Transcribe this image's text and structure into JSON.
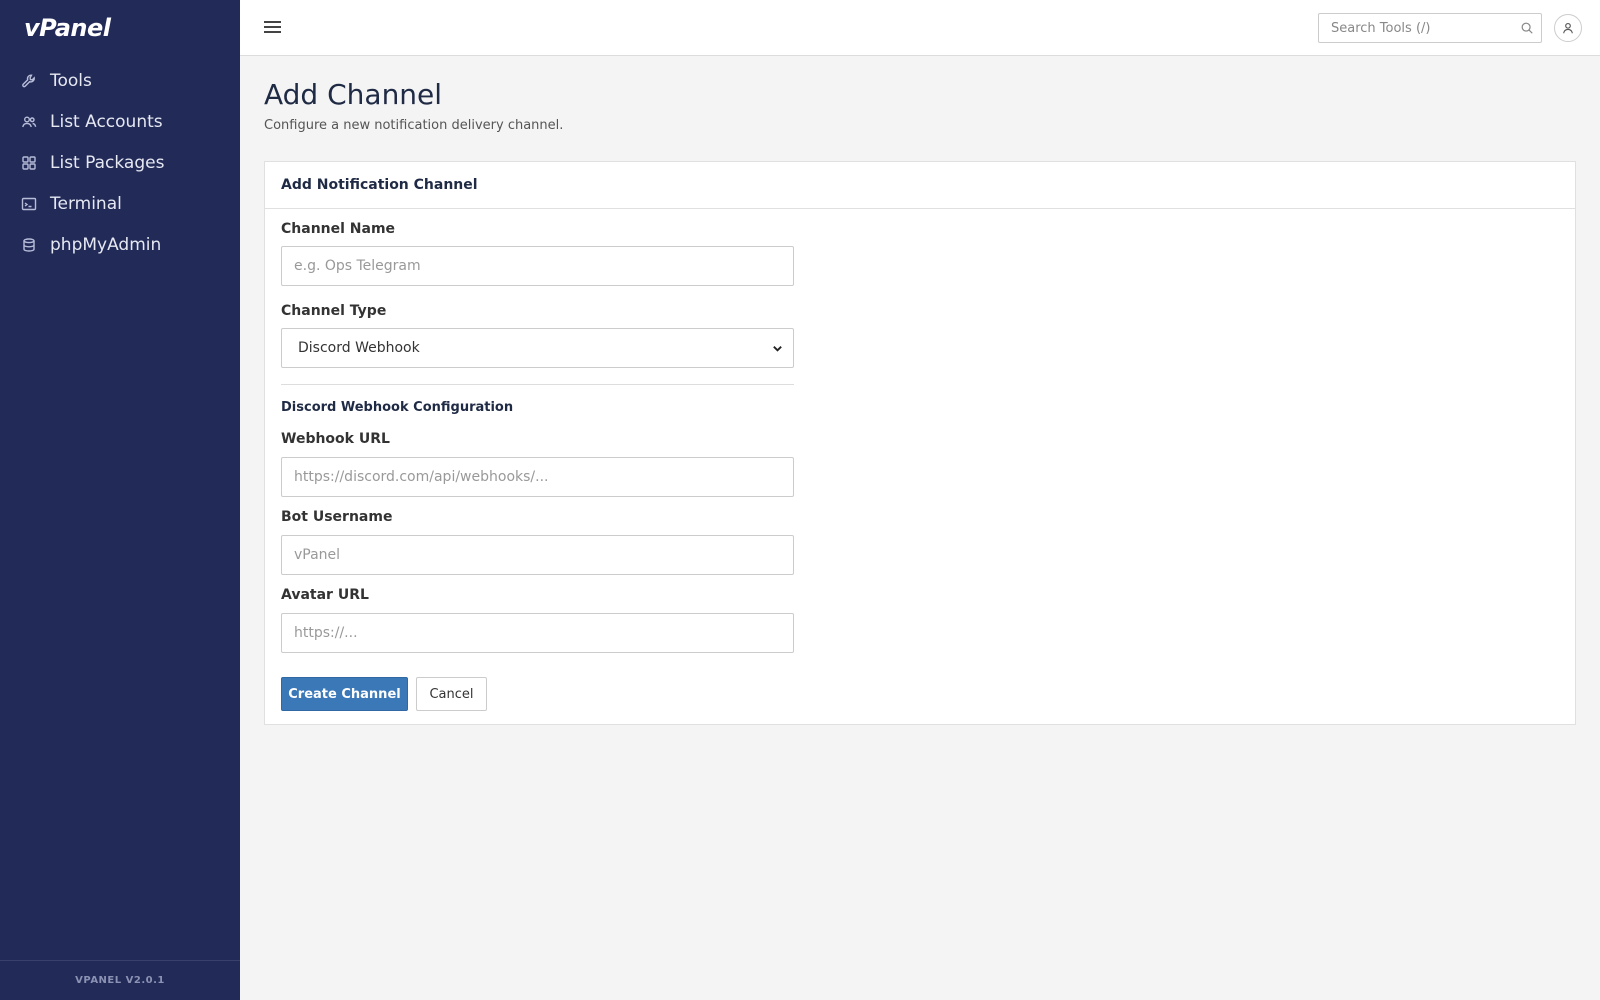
{
  "app": {
    "logo_text": "vPanel",
    "version": "VPANEL V2.0.1"
  },
  "sidebar": {
    "items": [
      {
        "label": "Tools",
        "icon": "wrench-icon"
      },
      {
        "label": "List Accounts",
        "icon": "users-icon"
      },
      {
        "label": "List Packages",
        "icon": "grid-icon"
      },
      {
        "label": "Terminal",
        "icon": "terminal-icon"
      },
      {
        "label": "phpMyAdmin",
        "icon": "database-icon"
      }
    ]
  },
  "topbar": {
    "search_placeholder": "Search Tools (/)"
  },
  "page": {
    "title": "Add Channel",
    "subtitle": "Configure a new notification delivery channel."
  },
  "card": {
    "title": "Add Notification Channel",
    "channel_name": {
      "label": "Channel Name",
      "placeholder": "e.g. Ops Telegram",
      "value": ""
    },
    "channel_type": {
      "label": "Channel Type",
      "selected": "Discord Webhook"
    },
    "section_title": "Discord Webhook Configuration",
    "webhook_url": {
      "label": "Webhook URL",
      "placeholder": "https://discord.com/api/webhooks/...",
      "value": ""
    },
    "bot_username": {
      "label": "Bot Username",
      "placeholder": "vPanel",
      "value": ""
    },
    "avatar_url": {
      "label": "Avatar URL",
      "placeholder": "https://...",
      "value": ""
    },
    "create_label": "Create Channel",
    "cancel_label": "Cancel"
  },
  "colors": {
    "sidebar_bg": "#222a58",
    "primary": "#3a78b8",
    "page_bg": "#f4f4f4"
  }
}
